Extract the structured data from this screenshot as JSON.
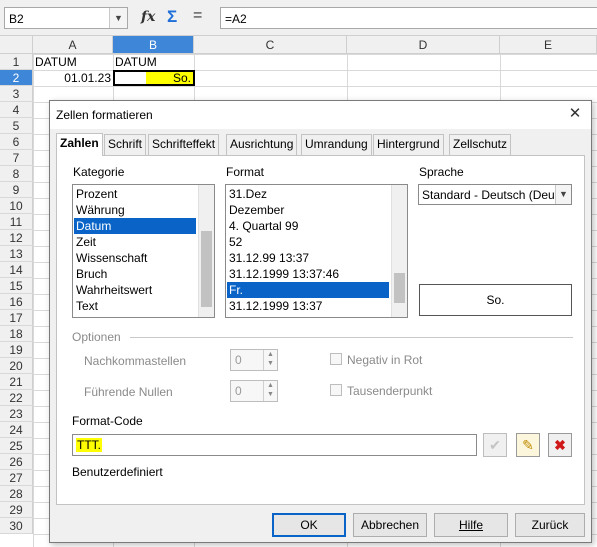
{
  "formula_bar": {
    "name_box": "B2",
    "formula": "=A2",
    "icons": [
      "function-wizard-icon",
      "sum-icon",
      "equals-icon"
    ]
  },
  "sheet": {
    "columns": [
      "A",
      "B",
      "C",
      "D",
      "E"
    ],
    "active_column": "B",
    "rows": [
      "1",
      "2",
      "3",
      "4",
      "5",
      "6",
      "7",
      "8",
      "9",
      "10",
      "11",
      "12",
      "13",
      "14",
      "15",
      "16",
      "17",
      "18",
      "19",
      "20",
      "21",
      "22",
      "23",
      "24",
      "25",
      "26",
      "27",
      "28",
      "29",
      "30"
    ],
    "active_row": "2",
    "cells": {
      "A1": "DATUM",
      "B1": "DATUM",
      "A2": "01.01.23",
      "B2": "So."
    },
    "highlight_color": "#ffff00",
    "selection_color": "#3d86d8"
  },
  "dialog": {
    "title": "Zellen formatieren",
    "tabs": [
      "Zahlen",
      "Schrift",
      "Schrifteffekt",
      "Ausrichtung",
      "Umrandung",
      "Hintergrund",
      "Zellschutz"
    ],
    "active_tab": "Zahlen",
    "category": {
      "label": "Kategorie",
      "items": [
        "Prozent",
        "Währung",
        "Datum",
        "Zeit",
        "Wissenschaft",
        "Bruch",
        "Wahrheitswert",
        "Text"
      ],
      "selected": "Datum"
    },
    "format": {
      "label": "Format",
      "items": [
        "31.Dez",
        "Dezember",
        "4. Quartal 99",
        "52",
        "31.12.99 13:37",
        "31.12.1999 13:37:46",
        "Fr.",
        "31.12.1999 13:37"
      ],
      "selected": "Fr."
    },
    "language": {
      "label": "Sprache",
      "value": "Standard - Deutsch (Deutschland)"
    },
    "preview": "So.",
    "options": {
      "label": "Optionen",
      "decimals_label": "Nachkommastellen",
      "decimals_value": "0",
      "leading_zeros_label": "Führende Nullen",
      "leading_zeros_value": "0",
      "negative_red_label": "Negativ in Rot",
      "thousands_sep_label": "Tausenderpunkt"
    },
    "format_code": {
      "label": "Format-Code",
      "value": "TTT.",
      "description": "Benutzerdefiniert"
    },
    "buttons": {
      "ok": "OK",
      "cancel": "Abbrechen",
      "help": "Hilfe",
      "reset": "Zurück"
    },
    "accent_color": "#0a64c8"
  }
}
